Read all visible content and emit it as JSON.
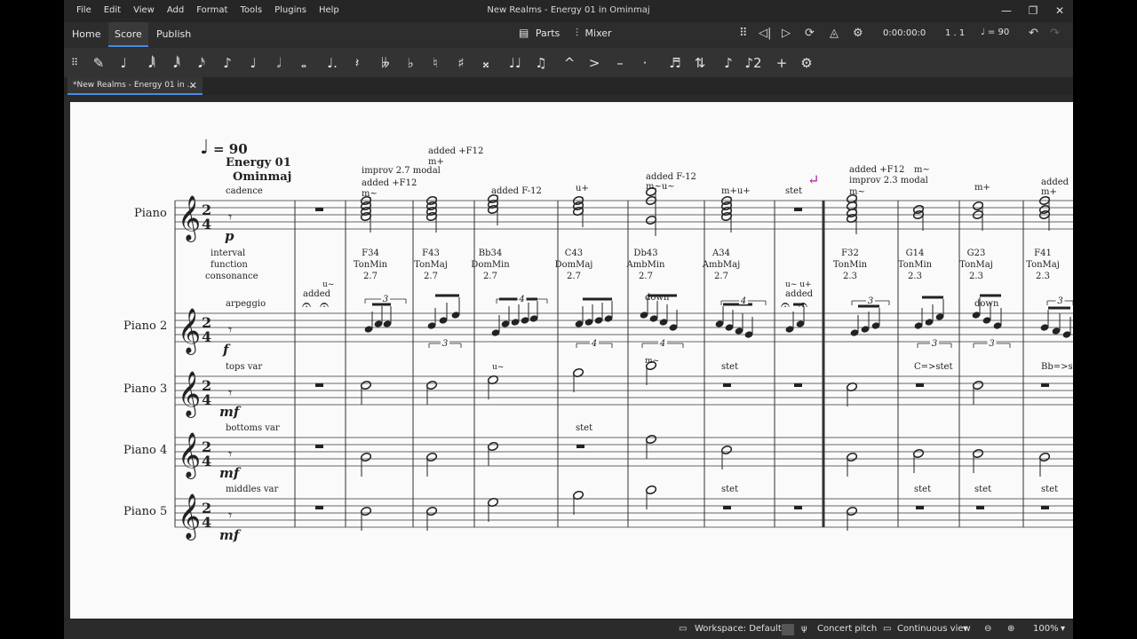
{
  "menu": [
    "File",
    "Edit",
    "View",
    "Add",
    "Format",
    "Tools",
    "Plugins",
    "Help"
  ],
  "window_title": "New Realms - Energy 01 in Ominmaj",
  "nav_tabs": [
    "Home",
    "Score",
    "Publish"
  ],
  "parts_label": "Parts",
  "mixer_label": "Mixer",
  "timecode": "0:00:00:0",
  "position": "1 . 1",
  "tempo_display": "♩ = 90",
  "doc_tab": "*New Realms - Energy 01 in ...",
  "score": {
    "tempo": "= 90",
    "title_line1": "Energy 01",
    "title_line2": "Ominmaj",
    "staves": [
      "Piano",
      "Piano 2",
      "Piano 3",
      "Piano 4",
      "Piano 5"
    ],
    "dynamics": [
      "p",
      "f",
      "mf",
      "mf",
      "mf"
    ],
    "staff_texts": [
      "cadence",
      "arpeggio",
      "tops var",
      "bottoms var",
      "middles var"
    ],
    "lyric_label": [
      "interval",
      "function",
      "consonance"
    ],
    "chord_labels": [
      {
        "name": "F34",
        "func": "TonMin",
        "val": "2.7"
      },
      {
        "name": "F43",
        "func": "TonMaj",
        "val": "2.7"
      },
      {
        "name": "Bb34",
        "func": "DomMin",
        "val": "2.7"
      },
      {
        "name": "C43",
        "func": "DomMaj",
        "val": "2.7"
      },
      {
        "name": "Db43",
        "func": "AmbMin",
        "val": "2.7"
      },
      {
        "name": "A34",
        "func": "AmbMaj",
        "val": "2.7"
      },
      {
        "name": "F32",
        "func": "TonMin",
        "val": "2.3"
      },
      {
        "name": "G14",
        "func": "TonMin",
        "val": "2.3"
      },
      {
        "name": "G23",
        "func": "TonMaj",
        "val": "2.3"
      },
      {
        "name": "F41",
        "func": "TonMaj",
        "val": "2.3"
      }
    ],
    "annotations": {
      "improv27": "improv 2.7 modal",
      "added_f12_plus_a": "added +F12",
      "m_tilde": "m~",
      "added_f12_plus_b": "added +F12",
      "m_plus": "m+",
      "added_f12_minus_a": "added F-12",
      "u_plus": "u+",
      "added_f12_minus_b": "added F-12",
      "m_tilde_u_tilde": "m~u~",
      "m_u_plus": "m+u+",
      "stet": "stet",
      "added_f12_plus_c": "added +F12",
      "improv23": "improv 2.3 modal",
      "m_tilde_b": "m~",
      "m_tilde_c": "m~",
      "m_plus_b": "m+",
      "added": "added",
      "m_plus_c": "m+",
      "u_tilde": "u~",
      "added_p2": "added",
      "down": "down",
      "u_tilde_u_plus": "u~  u+",
      "added_p2b": "added",
      "down_b": "down",
      "u_tilde_p3": "u~",
      "m_tilde_p3": "m~",
      "stet_p3": "stet",
      "c_stet": "C=>stet",
      "bb_stet": "Bb=>st",
      "stet_p4": "stet",
      "stet_p5a": "stet",
      "stet_p5b": "stet",
      "stet_p5c": "stet",
      "stet_p5d": "stet",
      "tuplet3": "3",
      "tuplet4": "4"
    }
  },
  "status": {
    "workspace": "Workspace: Default",
    "concert_pitch": "Concert pitch",
    "view_mode": "Continuous view",
    "zoom": "100%"
  },
  "colors": {
    "accent": "#4a8be3",
    "repeat_marker": "#a020a0"
  }
}
